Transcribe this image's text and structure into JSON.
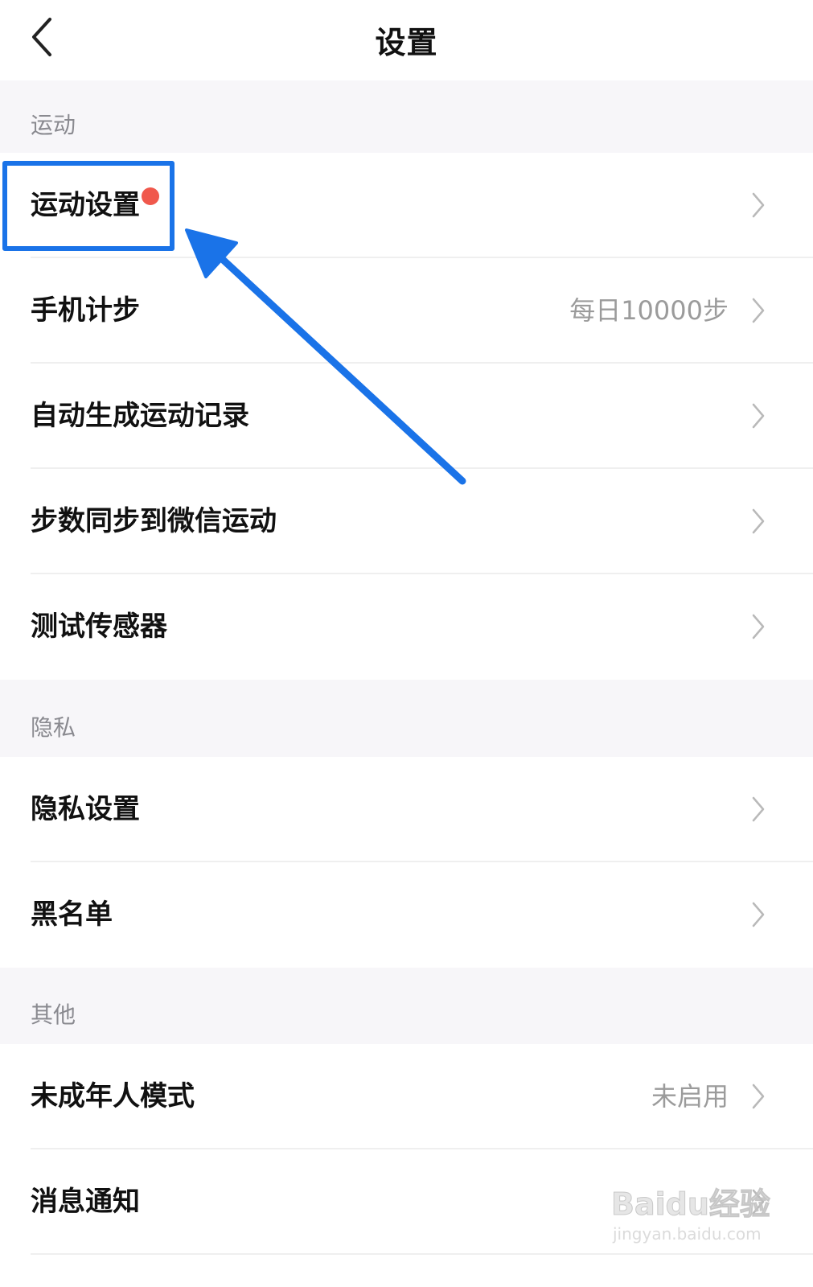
{
  "header": {
    "title": "设置",
    "back_icon": "chevron-left-icon"
  },
  "sections": [
    {
      "title": "运动",
      "items": [
        {
          "label": "运动设置",
          "value": "",
          "badge": "red-dot"
        },
        {
          "label": "手机计步",
          "value": "每日10000步"
        },
        {
          "label": "自动生成运动记录",
          "value": ""
        },
        {
          "label": "步数同步到微信运动",
          "value": ""
        },
        {
          "label": "测试传感器",
          "value": ""
        }
      ]
    },
    {
      "title": "隐私",
      "items": [
        {
          "label": "隐私设置",
          "value": ""
        },
        {
          "label": "黑名单",
          "value": ""
        }
      ]
    },
    {
      "title": "其他",
      "items": [
        {
          "label": "未成年人模式",
          "value": "未启用"
        },
        {
          "label": "消息通知",
          "value": ""
        }
      ]
    }
  ],
  "annotation": {
    "color": "#1a73e8",
    "target": "运动设置"
  },
  "watermark": {
    "main": "Baidu经验",
    "sub": "jingyan.baidu.com"
  },
  "colors": {
    "section_bg": "#f7f6f9",
    "badge": "#f0584c",
    "secondary_text": "#9b9b9b"
  }
}
